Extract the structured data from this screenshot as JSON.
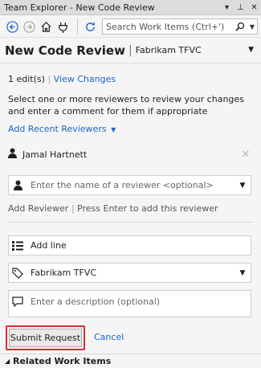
{
  "window": {
    "title": "Team Explorer - New Code Review",
    "menu_glyph": "▾",
    "pin_glyph": "⊥",
    "close_glyph": "✕"
  },
  "toolbar": {
    "search_placeholder": "Search Work Items (Ctrl+')"
  },
  "header": {
    "title": "New Code Review",
    "separator": "|",
    "context": "Fabrikam TFVC"
  },
  "edits": {
    "count_text": "1 edit(s)",
    "separator": "|",
    "view_changes": "View Changes"
  },
  "instructions": "Select one or more reviewers to review your changes and enter a comment for them if appropriate",
  "add_recent_reviewers": "Add Recent Reviewers",
  "reviewers": [
    {
      "name": "Jamal Hartnett"
    }
  ],
  "reviewer_input": {
    "placeholder": "Enter the name of a reviewer <optional>"
  },
  "add_reviewer": {
    "link": "Add Reviewer",
    "separator": "|",
    "hint": "Press Enter to add this reviewer"
  },
  "title_field": {
    "value": "Add line"
  },
  "repo_select": {
    "value": "Fabrikam TFVC"
  },
  "description_field": {
    "placeholder": "Enter a description (optional)"
  },
  "actions": {
    "submit": "Submit Request",
    "cancel": "Cancel"
  },
  "footer": {
    "section": "Related Work Items"
  },
  "colors": {
    "accent": "#1a66c9",
    "highlight": "#d32f2f"
  }
}
